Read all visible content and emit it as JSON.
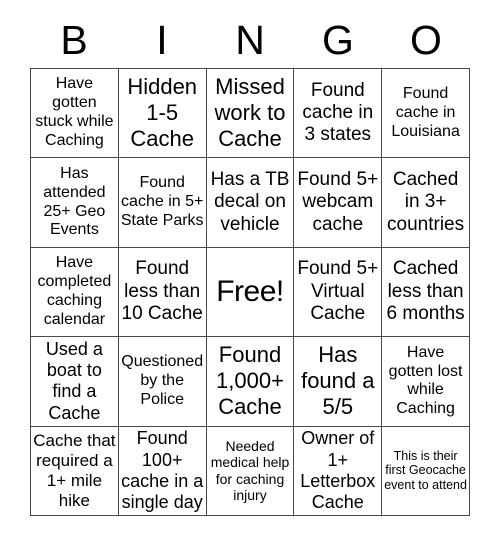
{
  "card": {
    "title_letters": [
      "B",
      "I",
      "N",
      "G",
      "O"
    ],
    "columns": 5,
    "rows": 5,
    "border_color": "#4a4a4a",
    "background_color": "#ffffff",
    "text_color": "#000000",
    "free_space": {
      "label": "Free!",
      "row": 3,
      "column": 3
    },
    "cells": [
      {
        "text": "Have gotten stuck while Caching",
        "size": "sm"
      },
      {
        "text": "Hidden 1-5 Cache",
        "size": "lg"
      },
      {
        "text": "Missed work to Cache",
        "size": "lg"
      },
      {
        "text": "Found cache in 3 states",
        "size": "md"
      },
      {
        "text": "Found cache in Louisiana",
        "size": "sm"
      },
      {
        "text": "Has attended 25+ Geo Events",
        "size": "sm"
      },
      {
        "text": "Found cache in 5+ State Parks",
        "size": "sm"
      },
      {
        "text": "Has a TB decal on vehicle",
        "size": "md"
      },
      {
        "text": "Found 5+ webcam cache",
        "size": "md"
      },
      {
        "text": "Cached in 3+ countries",
        "size": "md"
      },
      {
        "text": "Have completed caching calendar",
        "size": "sm"
      },
      {
        "text": "Found less than 10 Cache",
        "size": "md"
      },
      {
        "text": "Free!",
        "size": "xl"
      },
      {
        "text": "Found 5+ Virtual Cache",
        "size": "md"
      },
      {
        "text": "Cached less than 6 months",
        "size": "md"
      },
      {
        "text": "Used a boat to find a Cache",
        "size": "md"
      },
      {
        "text": "Questioned by the Police",
        "size": "sm"
      },
      {
        "text": "Found 1,000+ Cache",
        "size": "lg"
      },
      {
        "text": "Has found a 5/5",
        "size": "lg"
      },
      {
        "text": "Have gotten lost while Caching",
        "size": "sm"
      },
      {
        "text": "Cache that required a 1+ mile hike",
        "size": "md"
      },
      {
        "text": "Found 100+ cache in a single day",
        "size": "md"
      },
      {
        "text": "Needed medical help for caching injury",
        "size": "xs"
      },
      {
        "text": "Owner of 1+ Letterbox Cache",
        "size": "md"
      },
      {
        "text": "This is their first Geocache event to attend",
        "size": "xxs"
      }
    ]
  }
}
